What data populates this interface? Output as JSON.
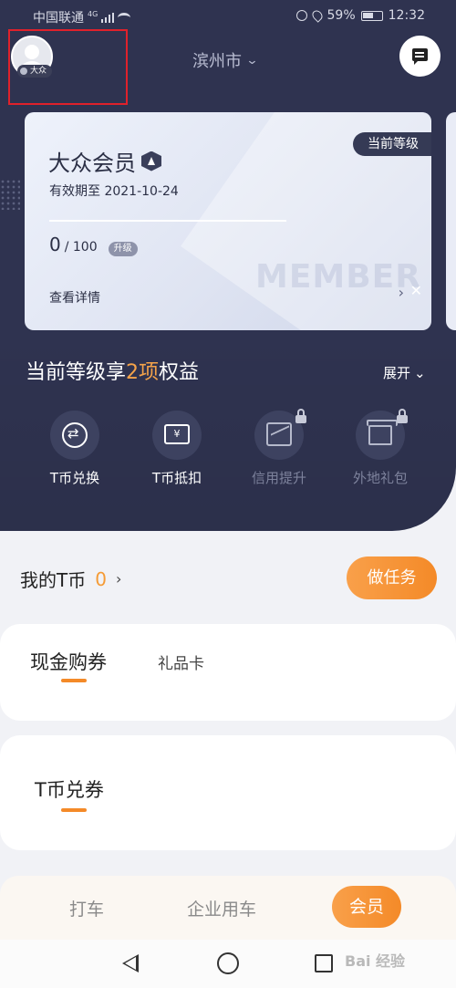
{
  "status_bar": {
    "carrier": "中国联通",
    "network": "4G",
    "battery": "59%",
    "time": "12:32"
  },
  "header": {
    "avatar_tag": "大众",
    "city": "滨州市",
    "city_chevron": "⌄"
  },
  "member_card": {
    "level_badge": "当前等级",
    "title": "大众会员",
    "expiry": "有效期至 2021-10-24",
    "points_current": "0",
    "points_total": "/ 100",
    "progress_fraction": 0,
    "upgrade_label": "升级",
    "watermark": "MEMBER",
    "details_label": "查看详情"
  },
  "benefits": {
    "title_prefix": "当前等级享",
    "title_highlight": "2项",
    "title_suffix": "权益",
    "expand_label": "展开",
    "items": [
      {
        "label": "T币兑换",
        "icon": "exchange-icon",
        "locked": false
      },
      {
        "label": "T币抵扣",
        "icon": "ticket-icon",
        "locked": false
      },
      {
        "label": "信用提升",
        "icon": "chart-icon",
        "locked": true
      },
      {
        "label": "外地礼包",
        "icon": "gift-icon",
        "locked": true
      }
    ]
  },
  "tcoin": {
    "label": "我的T币",
    "amount": "0",
    "task_button": "做任务"
  },
  "coupon_tabs": {
    "active": "现金购券",
    "inactive": "礼品卡"
  },
  "exchange_section": {
    "title": "T币兑券"
  },
  "bottom_nav": {
    "items": [
      "打车",
      "企业用车"
    ],
    "active": "会员"
  },
  "watermark": "Bai 经验",
  "colors": {
    "accent": "#f48a28",
    "dark_bg": "#2f3350",
    "highlight": "#f5a34a"
  }
}
